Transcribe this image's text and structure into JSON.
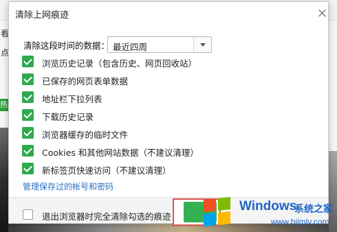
{
  "background": {
    "left_snippets": [
      "看",
      "点",
      "热"
    ]
  },
  "dialog": {
    "title": "清除上网痕迹",
    "range_label": "清除这段时间的数据：",
    "range_value": "最近四周",
    "options": [
      {
        "label": "浏览历史记录（包含历史、网页回收站）",
        "checked": true
      },
      {
        "label": "已保存的网页表单数据",
        "checked": true
      },
      {
        "label": "地址栏下拉列表",
        "checked": true
      },
      {
        "label": "下载历史记录",
        "checked": true
      },
      {
        "label": "浏览器缓存的临时文件",
        "checked": true
      },
      {
        "label": "Cookies 和其他网站数据（不建议清理）",
        "checked": true
      },
      {
        "label": "新标签页快速访问（不建议清理）",
        "checked": true
      }
    ],
    "manage_link": "管理保存过的帐号和密码",
    "exit_clear_label": "退出浏览器时完全清除勾选的痕迹",
    "exit_clear_checked": false
  },
  "watermark": {
    "brand": "Windows",
    "brand_cn": "系统之家",
    "url": "www.bjjmlv.com"
  },
  "colors": {
    "check_green": "#2ea94c",
    "link_blue": "#2a6fc4",
    "highlight_red": "#d9534f",
    "watermark_blue": "#1f66c6"
  }
}
